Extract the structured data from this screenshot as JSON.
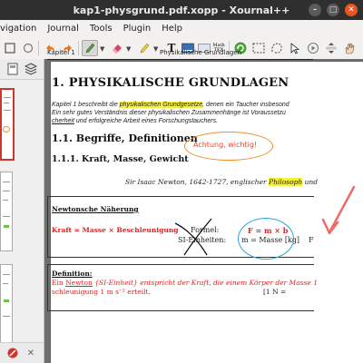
{
  "window": {
    "title": "kap1-physgrund.pdf.xopp - Xournal++"
  },
  "menu": [
    "vigation",
    "Journal",
    "Tools",
    "Plugin",
    "Help"
  ],
  "toolbar": {
    "icons": [
      "back-arrow-icon",
      "forward-arrow-icon",
      "pen-icon",
      "eraser-icon",
      "highlighter-icon",
      "text-tool-icon",
      "image-tool-icon",
      "math-tex-icon",
      "refresh-icon",
      "select-rect-icon",
      "select-region-icon",
      "hand-icon"
    ],
    "math_label": "Math\nTEX"
  },
  "document": {
    "header_left": "Kapitel 1",
    "header_center": "Physikalische Grundlagen",
    "heading1": "1.    PHYSIKALISCHE GRUNDLAGEN",
    "intro_line1_a": "Kapitel 1 beschreibt die ",
    "intro_line1_hl": "physikalischen Grundgesetze",
    "intro_line1_b": ", denen ein Taucher insbesond",
    "intro_line2": "Ein sehr gutes Verständnis dieser physikalischen Zusammenhänge ist Voraussetzu",
    "intro_line3_ul": "cherheit",
    "intro_line3_b": " und erfolgreiche Arbeit eines Forschungstauchers.",
    "heading2": "1.1.   Begriffe, Definitionen",
    "heading3": "1.1.1.   Kraft, Masse, Gewicht",
    "quote_a": "Sir Isaac Newton, 1642-1727, englischer ",
    "quote_hl": "Philosoph",
    "quote_b": " und",
    "box_title": "Newtonsche Näherung",
    "box_equation": "Kraft  =  Masse  ×  Beschleunigung",
    "formel_label": "Formel:",
    "si_label": "SI-Einheiten:",
    "formel_value": "F = m × b",
    "si_value": "m = Masse [kg]",
    "cut_f": "F",
    "def_title": "Definition:",
    "def1_a": "Ein ",
    "def1_newton": "Newton",
    "def1_b": "  {SI-Einheit}  entspricht der Kraft, die einem Körper der Masse 1 ",
    "def2": "schleunigung 1 m s⁻² erteilt.",
    "def2_right": "[1 N ="
  },
  "annotations": {
    "note_text": "Achtung, wichtig!",
    "note_color": "#e8432a",
    "oval_color": "#f28c28",
    "circle_color": "#2aa0e0"
  },
  "colors": {
    "page_border": "#d0352b",
    "highlight": "#f5f03a"
  }
}
